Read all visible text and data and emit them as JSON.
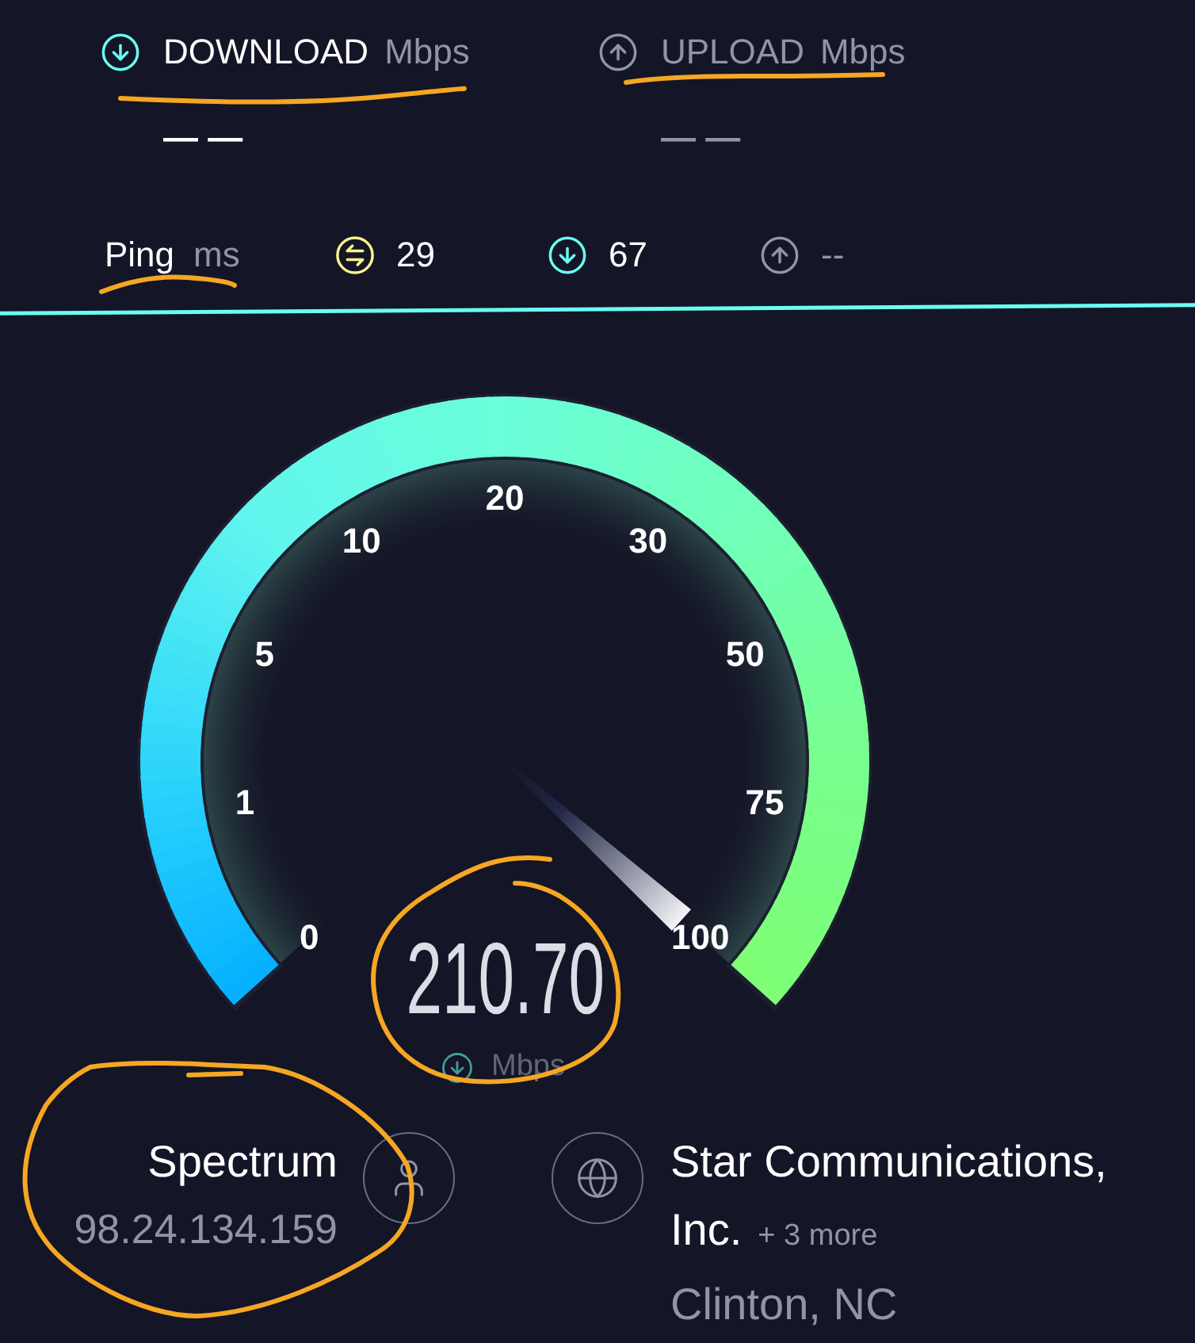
{
  "results": [
    {
      "kind": "download",
      "label": "DOWNLOAD",
      "unit": "Mbps",
      "value": "— —",
      "active": true
    },
    {
      "kind": "upload",
      "label": "UPLOAD",
      "unit": "Mbps",
      "value": "— —",
      "active": false
    }
  ],
  "ping": {
    "label": "Ping",
    "unit": "ms",
    "stats": [
      {
        "kind": "jitter",
        "value": "29",
        "active": true
      },
      {
        "kind": "download",
        "value": "67",
        "active": true
      },
      {
        "kind": "upload",
        "value": "--",
        "active": false
      }
    ]
  },
  "gauge": {
    "ticks": [
      "0",
      "1",
      "5",
      "10",
      "20",
      "30",
      "50",
      "75",
      "100"
    ],
    "level": 1,
    "value": "210.70",
    "unit": "Mbps"
  },
  "provider": {
    "name": "Spectrum",
    "ip": "98.24.134.159"
  },
  "server": {
    "name_lines": [
      "Star Communications,",
      "Inc."
    ],
    "more": "+ 3 more",
    "location": "Clinton, NC"
  }
}
